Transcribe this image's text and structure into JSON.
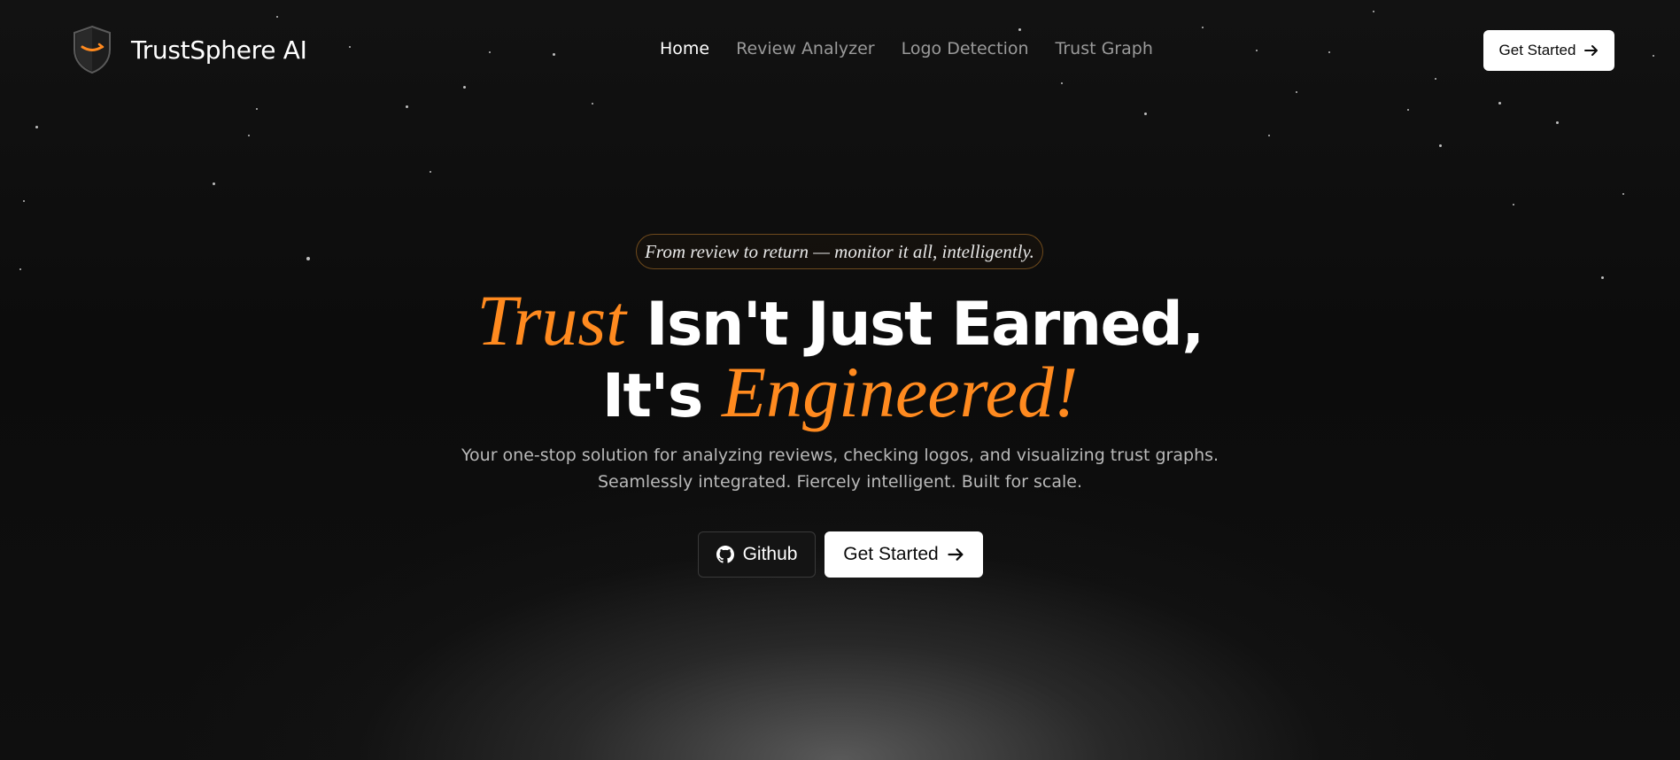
{
  "header": {
    "brand_name": "TrustSphere AI",
    "nav": [
      "Home",
      "Review Analyzer",
      "Logo Detection",
      "Trust Graph"
    ],
    "active_nav": "Home",
    "cta_label": "Get Started"
  },
  "hero": {
    "tagline": "From review to return — monitor it all, intelligently.",
    "headline_line1_accent": "Trust",
    "headline_line1_rest": " Isn't Just Earned,",
    "headline_line2_start": "It's ",
    "headline_line2_accent": "Engineered!",
    "subtitle_line1": "Your one-stop solution for analyzing reviews, checking logos, and visualizing trust graphs.",
    "subtitle_line2": "Seamlessly integrated. Fiercely intelligent. Built for scale.",
    "github_label": "Github",
    "start_label": "Get Started"
  },
  "icons": {
    "brand": "shield-logo-icon",
    "arrow": "arrow-right-icon",
    "github": "github-icon"
  },
  "colors": {
    "accent": "#ff8a1f",
    "background": "#0b0b0b",
    "button_bg": "#ffffff",
    "muted_text": "#9a9a9a"
  }
}
